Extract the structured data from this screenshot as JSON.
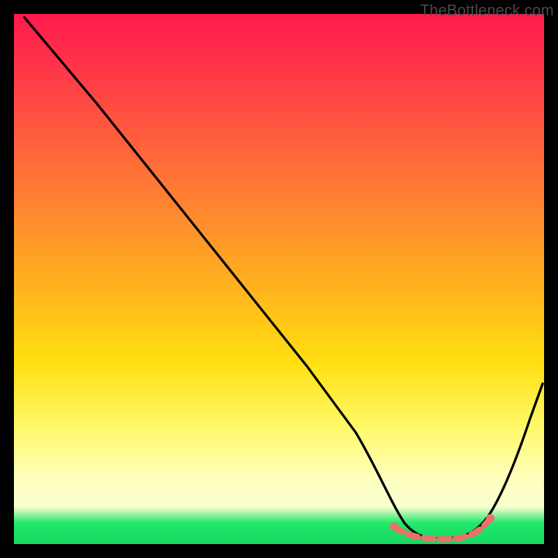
{
  "watermark": "TheBottleneck.com",
  "chart_data": {
    "type": "line",
    "title": "",
    "xlabel": "",
    "ylabel": "",
    "xlim": [
      0,
      100
    ],
    "ylim": [
      0,
      100
    ],
    "series": [
      {
        "name": "bottleneck-curve",
        "x": [
          0,
          10,
          20,
          30,
          40,
          50,
          60,
          68,
          72,
          76,
          80,
          84,
          88,
          92,
          96,
          100
        ],
        "values": [
          100,
          87,
          73,
          60,
          47,
          33,
          20,
          10,
          5,
          2,
          1,
          1,
          2,
          6,
          14,
          26
        ]
      }
    ],
    "highlight_band": {
      "x_start": 67,
      "x_end": 89,
      "note": "flat optimal zone (green)"
    },
    "gradient_stops": [
      {
        "pct": 0,
        "color": "#ff1a4d"
      },
      {
        "pct": 38,
        "color": "#ff8a2e"
      },
      {
        "pct": 66,
        "color": "#ffe012"
      },
      {
        "pct": 88,
        "color": "#ffffc0"
      },
      {
        "pct": 96,
        "color": "#23e86a"
      },
      {
        "pct": 100,
        "color": "#15d860"
      }
    ]
  }
}
